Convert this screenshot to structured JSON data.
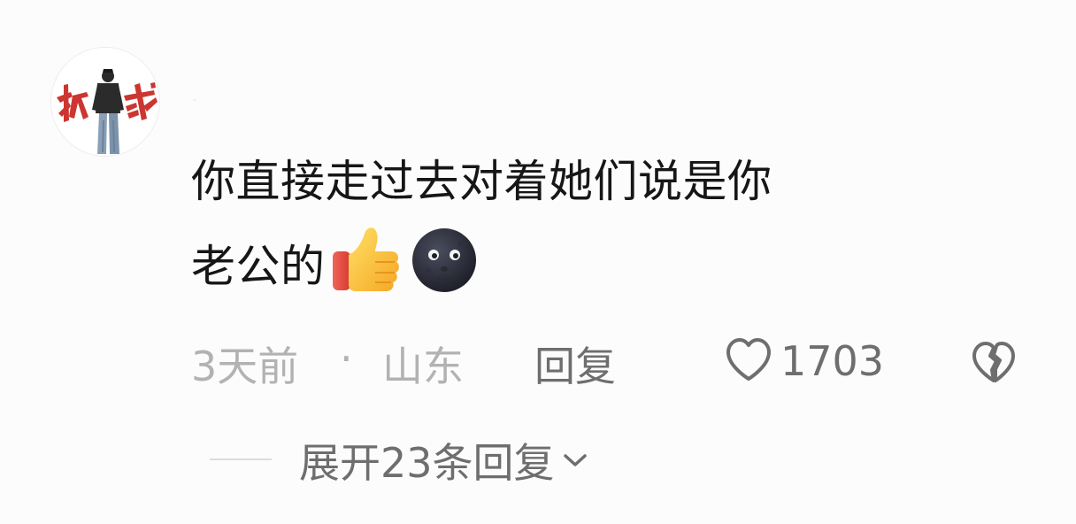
{
  "comment": {
    "username": "-",
    "text_line1": "你直接走过去对着她们说是你",
    "text_line2": "老公的",
    "emojis": [
      "thumbs-up-emoji",
      "new-moon-face-emoji"
    ],
    "time": "3天前",
    "separator": "·",
    "location": "山东",
    "reply_label": "回复",
    "like_count": "1703",
    "expand_label": "展开23条回复"
  },
  "colors": {
    "text": "#161616",
    "meta": "#b2b2b2",
    "action": "#6e6e6e",
    "avatar_accent": "#c8241f"
  },
  "icons": {
    "like": "heart-outline-icon",
    "dislike": "broken-heart-icon",
    "expand": "chevron-down-icon"
  }
}
